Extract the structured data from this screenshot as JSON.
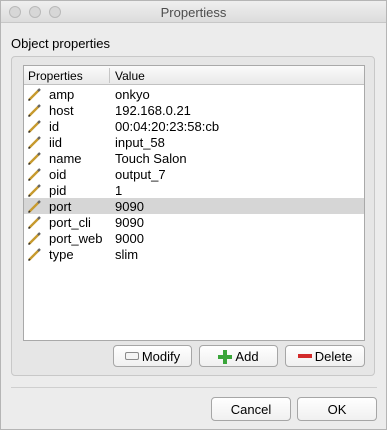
{
  "window": {
    "title": "Propertiess"
  },
  "group": {
    "label": "Object properties"
  },
  "table": {
    "columns": [
      "Properties",
      "Value"
    ],
    "rows": [
      {
        "key": "amp",
        "value": "onkyo"
      },
      {
        "key": "host",
        "value": "192.168.0.21"
      },
      {
        "key": "id",
        "value": "00:04:20:23:58:cb"
      },
      {
        "key": "iid",
        "value": "input_58"
      },
      {
        "key": "name",
        "value": "Touch Salon"
      },
      {
        "key": "oid",
        "value": "output_7"
      },
      {
        "key": "pid",
        "value": "1"
      },
      {
        "key": "port",
        "value": "9090",
        "selected": true
      },
      {
        "key": "port_cli",
        "value": "9090"
      },
      {
        "key": "port_web",
        "value": "9000"
      },
      {
        "key": "type",
        "value": "slim"
      }
    ],
    "row_icon": "pencil-icon"
  },
  "actions": {
    "modify_label": "Modify",
    "add_label": "Add",
    "delete_label": "Delete",
    "modify_icon": "modify-icon",
    "add_icon": "plus-icon",
    "delete_icon": "minus-icon",
    "add_color": "#3aa53a",
    "delete_color": "#d22a2a"
  },
  "dialog": {
    "cancel_label": "Cancel",
    "ok_label": "OK"
  }
}
